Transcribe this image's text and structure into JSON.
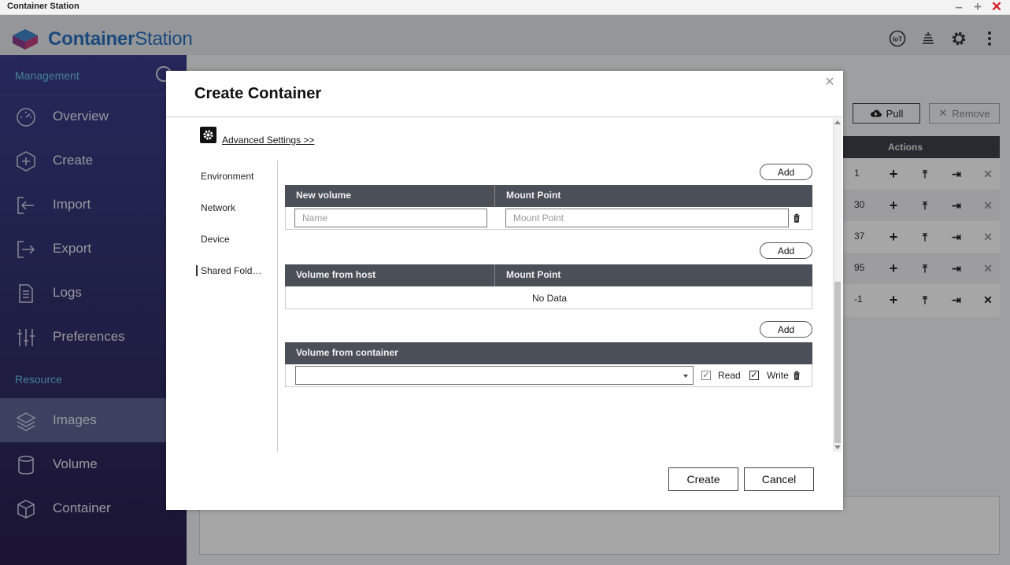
{
  "window": {
    "title": "Container Station"
  },
  "app": {
    "brand_main": "Container",
    "brand_sub": "Station"
  },
  "header_icons": [
    "iot-icon",
    "stack-icon",
    "gear-icon",
    "more-vertical-icon"
  ],
  "sidebar": {
    "management_label": "Management",
    "resource_label": "Resource",
    "items": [
      {
        "label": "Overview",
        "icon": "dashboard-icon"
      },
      {
        "label": "Create",
        "icon": "add-hexagon-icon"
      },
      {
        "label": "Import",
        "icon": "import-icon"
      },
      {
        "label": "Export",
        "icon": "export-icon"
      },
      {
        "label": "Logs",
        "icon": "document-icon"
      },
      {
        "label": "Preferences",
        "icon": "sliders-icon"
      }
    ],
    "resource_items": [
      {
        "label": "Images",
        "icon": "layers-icon",
        "active": true
      },
      {
        "label": "Volume",
        "icon": "database-icon"
      },
      {
        "label": "Container",
        "icon": "cube-icon"
      }
    ]
  },
  "background": {
    "pull_label": "Pull",
    "remove_label": "Remove",
    "actions_header": "Actions",
    "row_fragments": [
      "1",
      "30",
      "37",
      "95",
      "-1"
    ]
  },
  "modal": {
    "title": "Create Container",
    "advanced_link": "Advanced Settings >>",
    "tabs": [
      "Environment",
      "Network",
      "Device",
      "Shared Fold…"
    ],
    "active_tab": 3,
    "add_label": "Add",
    "new_volume": {
      "col1": "New volume",
      "col2": "Mount Point",
      "name_placeholder": "Name",
      "mount_placeholder": "Mount Point"
    },
    "host_volume": {
      "col1": "Volume from host",
      "col2": "Mount Point",
      "empty": "No Data"
    },
    "container_volume": {
      "col1": "Volume from container",
      "selected": "",
      "read_label": "Read",
      "write_label": "Write",
      "read_checked": true,
      "write_checked": true
    },
    "create_label": "Create",
    "cancel_label": "Cancel"
  }
}
